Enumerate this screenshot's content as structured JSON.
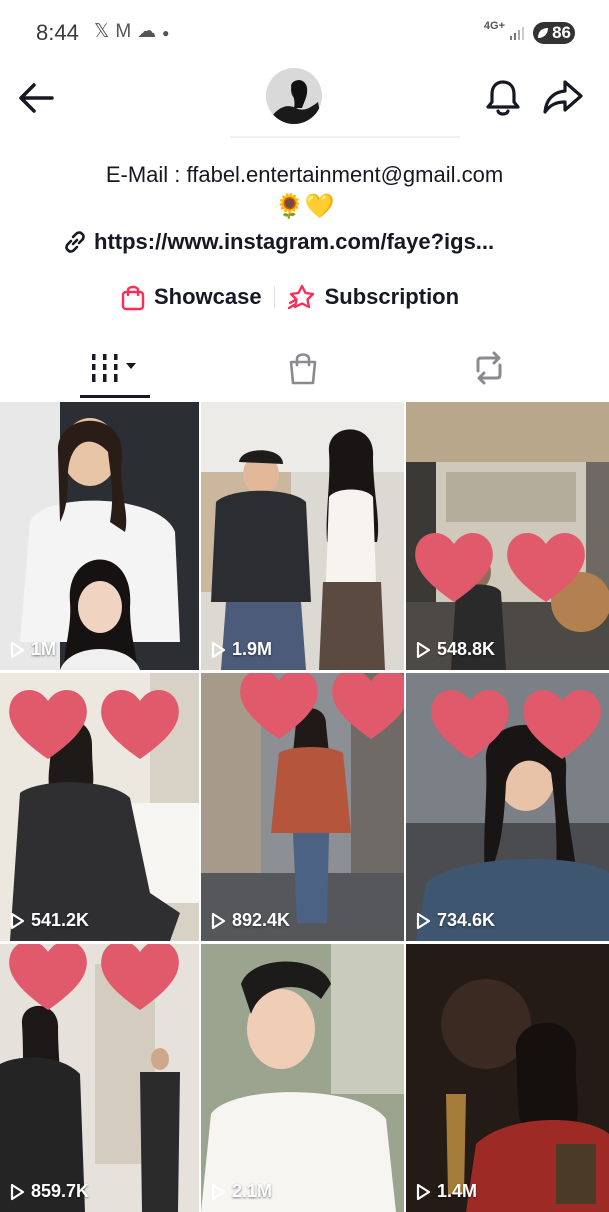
{
  "status_bar": {
    "time": "8:44",
    "icons": [
      "x-logo-icon",
      "gmail-icon",
      "cloud-icon",
      "dot-icon"
    ],
    "network": "4G+",
    "battery": "86"
  },
  "bio": {
    "email": "E-Mail : ffabel.entertainment@gmail.com",
    "emoji": "🌻💛",
    "link": "https://www.instagram.com/faye?igs..."
  },
  "features": {
    "showcase": "Showcase",
    "subscription": "Subscription"
  },
  "colors": {
    "accent": "#fe2c55",
    "heart": "#e05a6b",
    "text": "#161823"
  },
  "videos": [
    {
      "views": "1M"
    },
    {
      "views": "1.9M"
    },
    {
      "views": "548.8K"
    },
    {
      "views": "541.2K"
    },
    {
      "views": "892.4K"
    },
    {
      "views": "734.6K"
    },
    {
      "views": "859.7K"
    },
    {
      "views": "2.1M"
    },
    {
      "views": "1.4M"
    }
  ]
}
